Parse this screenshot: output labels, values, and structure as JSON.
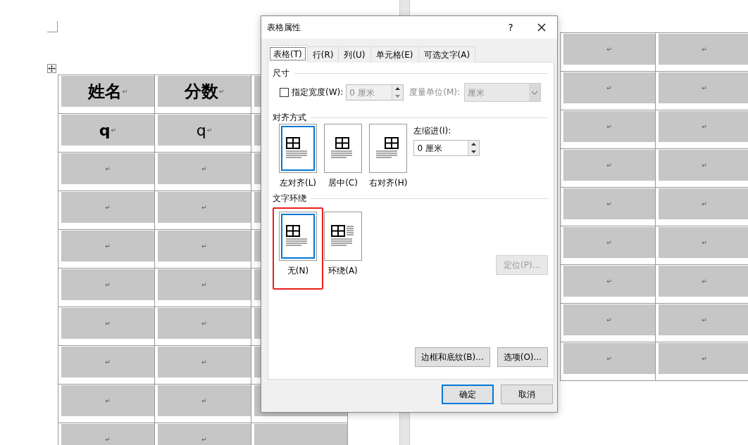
{
  "left_table": {
    "rows": [
      {
        "kind": "header",
        "cells": [
          {
            "text": "姓名",
            "mark": "↵",
            "bold": true
          },
          {
            "text": "分数",
            "mark": "↵",
            "bold": true
          }
        ]
      },
      {
        "kind": "data",
        "cells": [
          {
            "text": "q",
            "mark": "↵",
            "bold": true
          },
          {
            "text": "q",
            "mark": "↵",
            "bold": false
          }
        ]
      },
      {
        "cells": [
          {
            "mark": "↵"
          },
          {
            "mark": "↵"
          }
        ]
      },
      {
        "cells": [
          {
            "mark": "↵"
          },
          {
            "mark": "↵"
          }
        ]
      },
      {
        "cells": [
          {
            "mark": "↵"
          },
          {
            "mark": "↵"
          }
        ]
      },
      {
        "cells": [
          {
            "mark": "↵"
          },
          {
            "mark": "↵"
          }
        ]
      },
      {
        "cells": [
          {
            "mark": "↵"
          },
          {
            "mark": "↵"
          }
        ]
      },
      {
        "cells": [
          {
            "mark": "↵"
          },
          {
            "mark": "↵"
          }
        ]
      },
      {
        "cells": [
          {
            "mark": "↵"
          },
          {
            "mark": "↵"
          }
        ]
      },
      {
        "cells": [
          {
            "mark": "↵"
          },
          {
            "mark": "↵"
          }
        ]
      }
    ]
  },
  "right_table": {
    "rows": [
      {
        "cells": [
          {
            "mark": "↵"
          },
          {
            "mark": "↵"
          }
        ]
      },
      {
        "cells": [
          {
            "mark": "↵"
          },
          {
            "mark": "↵"
          }
        ]
      },
      {
        "cells": [
          {
            "mark": "↵"
          },
          {
            "mark": "↵"
          }
        ]
      },
      {
        "cells": [
          {
            "mark": "↵"
          },
          {
            "mark": "↵"
          }
        ]
      },
      {
        "cells": [
          {
            "mark": "↵"
          },
          {
            "mark": "↵"
          }
        ]
      },
      {
        "cells": [
          {
            "mark": "↵"
          },
          {
            "mark": "↵"
          }
        ]
      },
      {
        "cells": [
          {
            "mark": "↵"
          },
          {
            "mark": "↵"
          }
        ]
      },
      {
        "cells": [
          {
            "mark": "↵"
          },
          {
            "mark": "↵"
          }
        ]
      },
      {
        "cells": [
          {
            "mark": "↵"
          },
          {
            "mark": "↵"
          }
        ]
      }
    ]
  },
  "dialog": {
    "title": "表格属性",
    "help": "?",
    "tabs": [
      {
        "label": "表格(T)",
        "selected": true
      },
      {
        "label": "行(R)",
        "selected": false
      },
      {
        "label": "列(U)",
        "selected": false
      },
      {
        "label": "单元格(E)",
        "selected": false
      },
      {
        "label": "可选文字(A)",
        "selected": false
      }
    ],
    "size_section": {
      "heading": "尺寸",
      "width_checkbox": {
        "label": "指定宽度(W):",
        "checked": false
      },
      "width_field": {
        "value": "0 厘米",
        "disabled": true
      },
      "unit_label": {
        "text": "度量单位(M):",
        "disabled": true
      },
      "unit_dropdown": {
        "value": "厘米",
        "disabled": true
      }
    },
    "alignment_section": {
      "heading": "对齐方式",
      "options": [
        {
          "label": "左对齐(L)",
          "kind": "left",
          "selected": true
        },
        {
          "label": "居中(C)",
          "kind": "center",
          "selected": false
        },
        {
          "label": "右对齐(H)",
          "kind": "right",
          "selected": false
        }
      ],
      "indent_label": "左缩进(I):",
      "indent_field": {
        "value": "0 厘米",
        "disabled": false
      }
    },
    "wrap_section": {
      "heading": "文字环绕",
      "options": [
        {
          "label": "无(N)",
          "kind": "none",
          "selected": true,
          "highlighted": true
        },
        {
          "label": "环绕(A)",
          "kind": "around",
          "selected": false,
          "highlighted": false
        }
      ],
      "position_button": {
        "label": "定位(P)...",
        "disabled": true
      }
    },
    "panel_buttons": [
      "边框和底纹(B)...",
      "选项(O)..."
    ],
    "footer_buttons": [
      {
        "label": "确定",
        "default": true
      },
      {
        "label": "取消",
        "default": false
      }
    ]
  }
}
